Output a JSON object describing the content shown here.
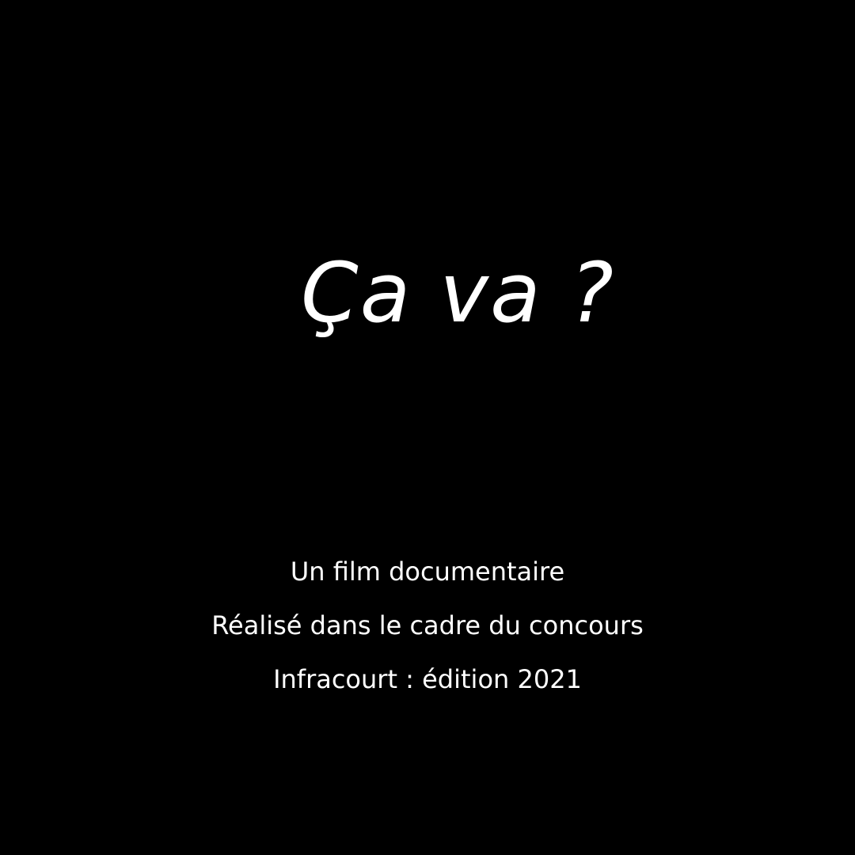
{
  "title": "Ça va ?",
  "credits": [
    "Un film documentaire",
    "Réalisé dans le cadre du concours",
    "Infracourt : édition 2021"
  ],
  "colors": {
    "background": "#000000",
    "text": "#ffffff"
  }
}
